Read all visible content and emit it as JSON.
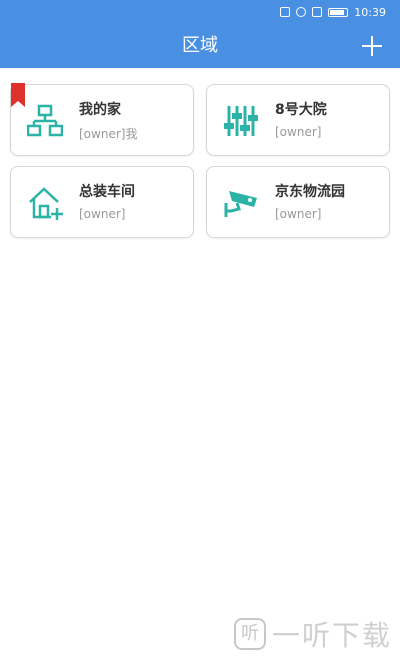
{
  "status_bar": {
    "time": "10:39"
  },
  "header": {
    "title": "区域",
    "add_icon": "plus-icon"
  },
  "areas": [
    {
      "name": "我的家",
      "owner": "[owner]我",
      "icon": "network-icon",
      "bookmarked": true
    },
    {
      "name": "8号大院",
      "owner": "[owner]",
      "icon": "sliders-icon",
      "bookmarked": false
    },
    {
      "name": "总装车间",
      "owner": "[owner]",
      "icon": "house-add-icon",
      "bookmarked": false
    },
    {
      "name": "京东物流园",
      "owner": "[owner]",
      "icon": "camera-icon",
      "bookmarked": false
    }
  ],
  "watermark": {
    "logo": "听",
    "text": "一听下载"
  },
  "colors": {
    "primary": "#4a90e2",
    "icon_teal": "#2bb3a8",
    "bookmark": "#e0322d"
  }
}
